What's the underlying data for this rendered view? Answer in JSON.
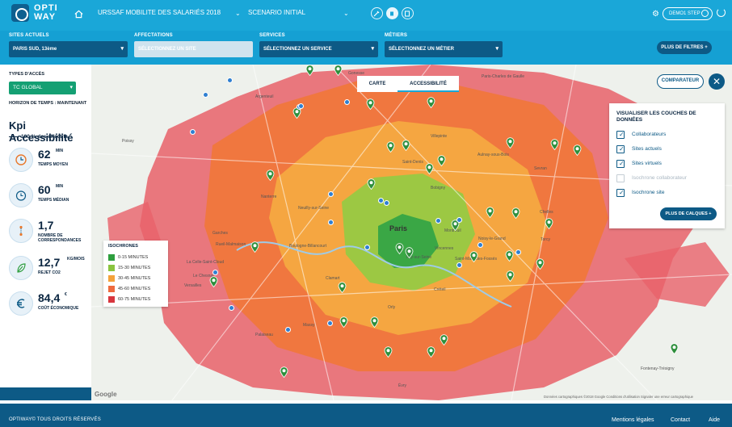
{
  "app": {
    "logo_line1": "OPTI",
    "logo_line2": "WAY"
  },
  "header": {
    "project": "URSSAF MOBILITE DES SALARIÉS 2018",
    "scenario": "SCENARIO INITIAL",
    "user": "DEMO1 STEP"
  },
  "filters": {
    "sites_label": "SITES ACTUELS",
    "sites_value": "PARIS SUD, 13ème",
    "affectations_label": "AFFECTATIONS",
    "affectations_value": "SÉLECTIONNEZ UN SITE",
    "services_label": "SERVICES",
    "services_value": "SÉLECTIONNEZ UN SERVICE",
    "metiers_label": "MÉTIERS",
    "metiers_value": "SÉLECTIONNEZ UN MÉTIER",
    "more_filters": "PLUS DE FILTRES +"
  },
  "left": {
    "access_type_label": "TYPES D'ACCÈS",
    "access_type_value": "TC GLOBAL",
    "horizon": "HORIZON DE TEMPS : MAINTENANT",
    "kpi_title": "Kpi Accessibilité",
    "kpi_subtitle": "100 % des effectifs",
    "kpis": [
      {
        "value": "62",
        "unit": "MIN",
        "label": "TEMPS MOYEN",
        "icon": "clock-icon"
      },
      {
        "value": "60",
        "unit": "MIN",
        "label": "TEMPS MÉDIAN",
        "icon": "stopwatch-icon"
      },
      {
        "value": "1,7",
        "unit": "",
        "label": "NOMBRE DE CORRESPONDANCES",
        "icon": "route-icon"
      },
      {
        "value": "12,7",
        "unit": "KG/MOIS",
        "label": "REJET CO2",
        "icon": "leaf-icon"
      },
      {
        "value": "84,4",
        "unit": "€",
        "label": "COÛT ÉCONOMIQUE",
        "icon": "euro-icon"
      }
    ]
  },
  "map": {
    "tab_carte": "CARTE",
    "tab_accessibilite": "ACCESSIBILITÉ",
    "comparateur": "COMPARATEUR",
    "close_symbol": "✕",
    "layers_title": "VISUALISER LES COUCHES DE DONNÉES",
    "layers": [
      {
        "label": "Collaborateurs",
        "checked": true
      },
      {
        "label": "Sites actuels",
        "checked": true
      },
      {
        "label": "Sites virtuels",
        "checked": true
      },
      {
        "label": "Isochrone collaborateur",
        "checked": false
      },
      {
        "label": "Isochrone site",
        "checked": true
      }
    ],
    "more_layers": "PLUS DE CALQUES +",
    "legend_title": "ISOCHRONES",
    "legend": [
      {
        "label": "0-15 MINUTES",
        "color": "#2e9e3e"
      },
      {
        "label": "15-30 MINUTES",
        "color": "#8ac43f"
      },
      {
        "label": "30-45 MINUTES",
        "color": "#f4a23a"
      },
      {
        "label": "45-60 MINUTES",
        "color": "#ef6a3e"
      },
      {
        "label": "60-75 MINUTES",
        "color": "#d8363e"
      }
    ],
    "google": "Google",
    "attribution": "Données cartographiques ©2018 Google   Conditions d'utilisation   Signaler une erreur cartographique",
    "places": {
      "paris": "Paris",
      "saint_denis": "Saint-Denis",
      "versailles": "Versailles",
      "creteil": "Créteil",
      "bobigny": "Bobigny",
      "nanterre": "Nanterre",
      "argenteuil": "Argenteuil",
      "massy": "Massy",
      "clamart": "Clamart",
      "vincennes": "Vincennes",
      "montreuil": "Montreuil",
      "aulnay": "Aulnay-sous-Bois",
      "sevran": "Sevran",
      "garches": "Garches",
      "chelles": "Chelles",
      "ivry": "Ivry-sur-Seine",
      "fontenay": "Fontenay-Trésigny",
      "roissy": "Paris-Charles de Gaulle",
      "noisy": "Noisy-le-Grand",
      "neuilly": "Neuilly-sur-Seine",
      "boulogne": "Boulogne-Billancourt",
      "saint_maur": "Saint-Maur-des-Fossés",
      "palaiseau": "Palaiseau",
      "evry": "Évry",
      "rueil": "Rueil-Malmaison",
      "poissy": "Poissy",
      "gonesse": "Gonesse",
      "le_chesnay": "Le Chesnay",
      "la_celle": "La Celle-Saint-Cloud",
      "orly": "Orly",
      "torcy": "Torcy",
      "villepinte": "Villepinte"
    }
  },
  "footer": {
    "copyright": "OPTIWAY© TOUS DROITS RÉSERVÉS",
    "legal": "Mentions légales",
    "contact": "Contact",
    "help": "Aide"
  }
}
